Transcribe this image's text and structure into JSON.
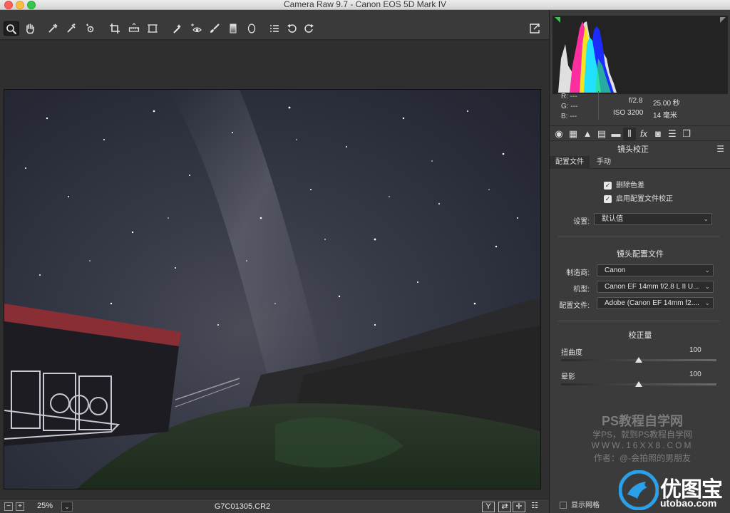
{
  "window": {
    "title": "Camera Raw 9.7 -  Canon EOS 5D Mark IV"
  },
  "toolbar": {
    "tools": [
      {
        "name": "zoom-tool",
        "glyph": "🔍"
      },
      {
        "name": "hand-tool",
        "glyph": "✋"
      },
      {
        "name": "white-balance-tool",
        "glyph": "✒"
      },
      {
        "name": "color-sampler-tool",
        "glyph": "✎"
      },
      {
        "name": "targeted-adjustment-tool",
        "glyph": "◎"
      },
      {
        "name": "crop-tool",
        "glyph": "⌗"
      },
      {
        "name": "straighten-tool",
        "glyph": "▭"
      },
      {
        "name": "transform-tool",
        "glyph": "⊡"
      },
      {
        "name": "spot-removal-tool",
        "glyph": "✐"
      },
      {
        "name": "red-eye-tool",
        "glyph": "⊹"
      },
      {
        "name": "adjustment-brush-tool",
        "glyph": "✏"
      },
      {
        "name": "graduated-filter-tool",
        "glyph": "▮"
      },
      {
        "name": "radial-filter-tool",
        "glyph": "◯"
      },
      {
        "name": "preferences-tool",
        "glyph": "☰"
      },
      {
        "name": "rotate-left-tool",
        "glyph": "↺"
      },
      {
        "name": "rotate-right-tool",
        "glyph": "↻"
      }
    ]
  },
  "status": {
    "zoom": "25%",
    "filename": "G7C01305.CR2",
    "zoom_minus": "−",
    "zoom_plus": "+",
    "zoom_drop": "⌄",
    "btn_y": "Y",
    "btn_swap": "⇄",
    "btn_cross": "✛",
    "btn_settings": "☷"
  },
  "info": {
    "r": "R:  ---",
    "g": "G:  ---",
    "b": "B:  ---",
    "aperture": "f/2.8",
    "shutter": "25.00 秒",
    "iso": "ISO 3200",
    "focal": "14 毫米"
  },
  "panel": {
    "section_title": "镜头校正",
    "subtab_profile": "配置文件",
    "subtab_manual": "手动",
    "chk_remove_ca": "删除色差",
    "chk_enable_profile": "启用配置文件校正",
    "setup_label": "设置:",
    "setup_value": "默认值",
    "lens_profile_title": "镜头配置文件",
    "make_label": "制造商:",
    "make_value": "Canon",
    "model_label": "机型:",
    "model_value": "Canon EF 14mm f/2.8 L II U...",
    "profile_label": "配置文件:",
    "profile_value": "Adobe (Canon EF 14mm f2....",
    "amount_title": "校正量",
    "distortion_label": "扭曲度",
    "distortion_value": "100",
    "vignetting_label": "晕影",
    "vignetting_value": "100",
    "show_grid": "显示网格"
  },
  "sliders": {
    "distortion_fraction": 0.5,
    "vignetting_fraction": 0.5
  },
  "watermark": {
    "line1": "PS教程自学网",
    "line2": "学PS，就到PS教程自学网",
    "line3": "WWW.16XX8.COM",
    "line4": "作者：@-会拍照的男朋友"
  },
  "brand": {
    "name": "优图宝",
    "url": "utobao.com"
  },
  "colors": {
    "accent": "#34c84a",
    "panel": "#3b3b3b",
    "bg": "#2f2f2f"
  }
}
